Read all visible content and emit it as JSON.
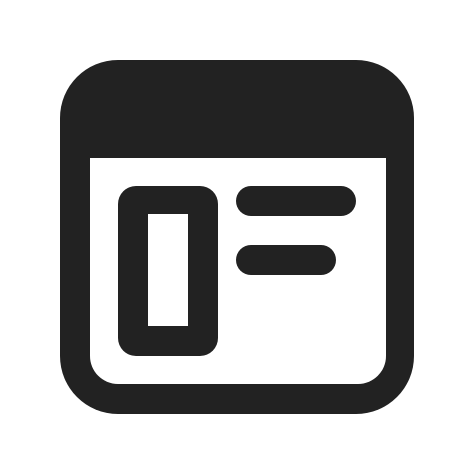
{
  "icon": {
    "name": "browser-window-icon",
    "color": "#222222",
    "background": "#ffffff"
  }
}
